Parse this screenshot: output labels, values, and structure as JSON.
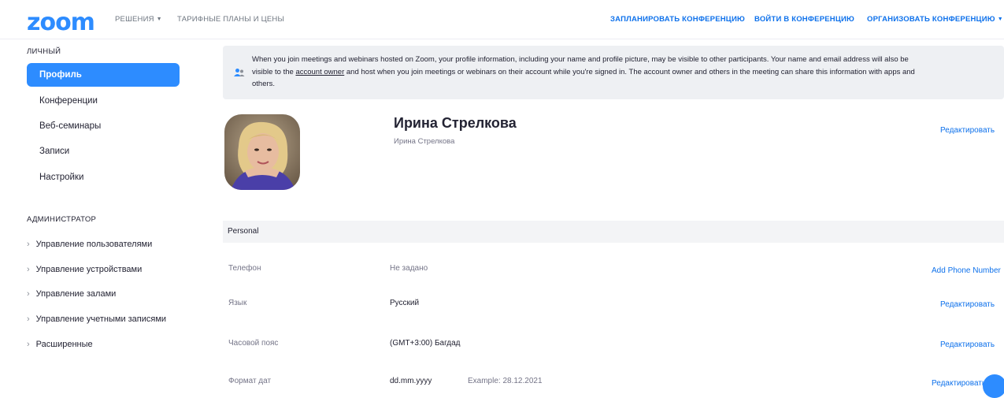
{
  "logo": "zoom",
  "nav": {
    "solutions": "РЕШЕНИЯ",
    "plans": "ТАРИФНЫЕ ПЛАНЫ И ЦЕНЫ",
    "schedule": "ЗАПЛАНИРОВАТЬ КОНФЕРЕНЦИЮ",
    "join": "ВОЙТИ В КОНФЕРЕНЦИЮ",
    "host": "ОРГАНИЗОВАТЬ КОНФЕРЕНЦИЮ"
  },
  "sidebar": {
    "personal_title": "ЛИЧНЫЙ",
    "items": [
      {
        "label": "Профиль"
      },
      {
        "label": "Конференции"
      },
      {
        "label": "Веб-семинары"
      },
      {
        "label": "Записи"
      },
      {
        "label": "Настройки"
      }
    ],
    "admin_title": "АДМИНИСТРАТОР",
    "admin_items": [
      {
        "label": "Управление пользователями"
      },
      {
        "label": "Управление устройствами"
      },
      {
        "label": "Управление залами"
      },
      {
        "label": "Управление учетными записями"
      },
      {
        "label": "Расширенные"
      }
    ]
  },
  "notice": {
    "part1": "When you join meetings and webinars hosted on Zoom, your profile information, including your name and profile picture, may be visible to other participants. Your name and email address will also be visible to the ",
    "link": "account owner",
    "part2": " and host when you join meetings or webinars on their account while you're signed in. The account owner and others in the meeting can share this information with apps and others."
  },
  "profile": {
    "name": "Ирина Стрелкова",
    "display_name": "Ирина Стрелкова",
    "edit_label": "Редактировать"
  },
  "personal": {
    "section_title": "Personal",
    "rows": [
      {
        "label": "Телефон",
        "value": "Не задано",
        "action": "Add Phone Number"
      },
      {
        "label": "Язык",
        "value": "Русский",
        "action": "Редактировать"
      },
      {
        "label": "Часовой пояс",
        "value": "(GMT+3:00) Багдад",
        "action": "Редактировать"
      },
      {
        "label": "Формат дат",
        "value": "dd.mm.yyyy",
        "extra": "Example: 28.12.2021",
        "action": "Редактировать"
      }
    ]
  },
  "colors": {
    "brand": "#2d8cff",
    "link": "#0e71eb"
  }
}
